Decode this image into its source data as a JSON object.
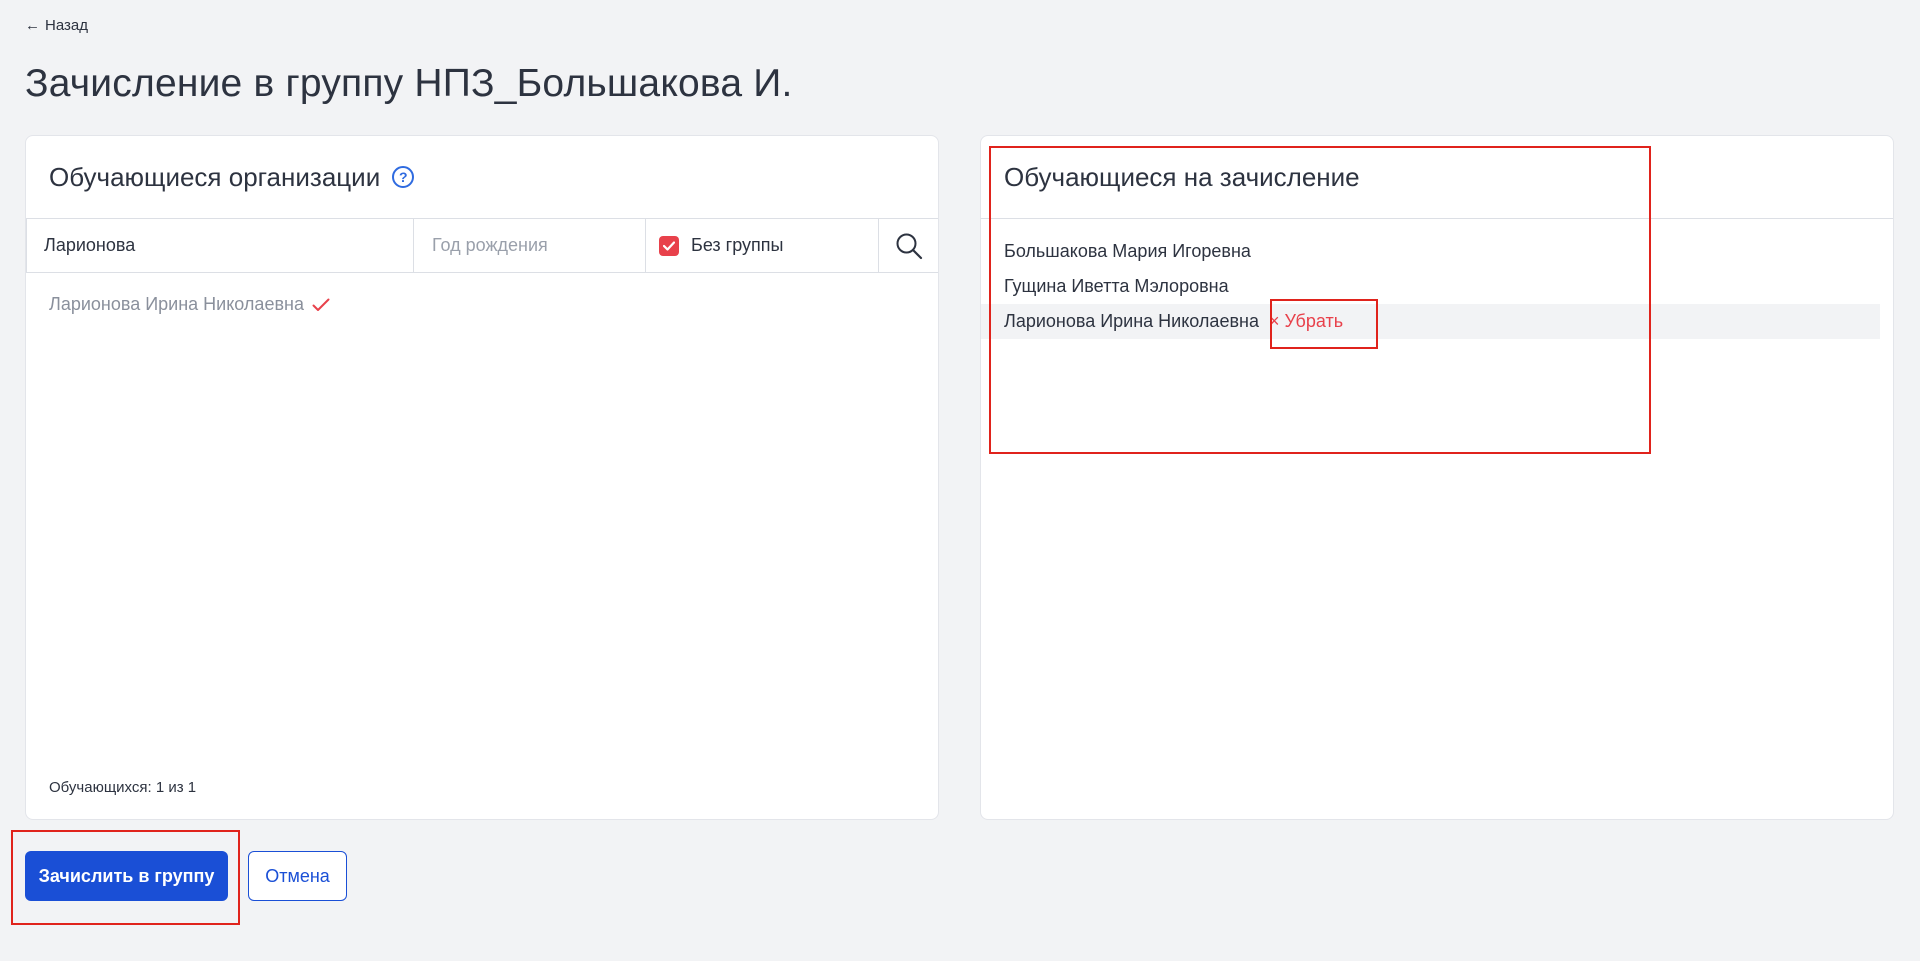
{
  "nav": {
    "back_label": "Назад"
  },
  "page": {
    "title": "Зачисление в группу НПЗ_Большакова И."
  },
  "left_panel": {
    "title": "Обучающиеся организации",
    "filters": {
      "name_value": "Ларионова",
      "year_placeholder": "Год рождения",
      "no_group_label": "Без группы",
      "no_group_checked": true
    },
    "results": [
      {
        "name": "Ларионова Ирина Николаевна",
        "selected": true
      }
    ],
    "counter": "Обучающихся: 1 из 1"
  },
  "right_panel": {
    "title": "Обучающиеся на зачисление",
    "students": [
      {
        "name": "Большакова Мария Игоревна"
      },
      {
        "name": "Гущина Иветта Мэлоровна"
      },
      {
        "name": "Ларионова Ирина Николаевна",
        "remove_label": "× Убрать"
      }
    ]
  },
  "actions": {
    "enroll_label": "Зачислить в группу",
    "cancel_label": "Отмена"
  },
  "colors": {
    "accent": "#1a4fd6",
    "danger": "#e8414b",
    "highlight": "#e0231c"
  }
}
